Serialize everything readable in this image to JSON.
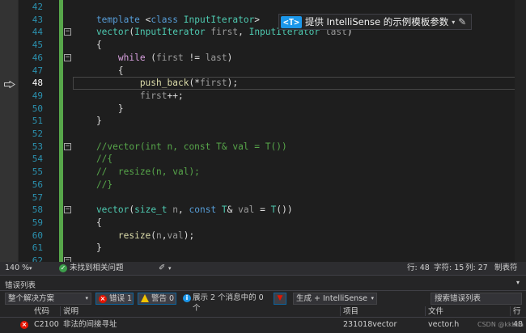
{
  "editor": {
    "lines": [
      {
        "n": "42",
        "fold": "",
        "tokens": [
          {
            "t": "",
            "c": ""
          }
        ]
      },
      {
        "n": "43",
        "fold": "",
        "tokens": [
          {
            "t": "    template ",
            "c": "kw"
          },
          {
            "t": "<",
            "c": ""
          },
          {
            "t": "class ",
            "c": "kw"
          },
          {
            "t": "InputIterator",
            "c": "tp"
          },
          {
            "t": ">",
            "c": ""
          }
        ]
      },
      {
        "n": "44",
        "fold": "−",
        "tokens": [
          {
            "t": "    vector",
            "c": "tp"
          },
          {
            "t": "(",
            "c": ""
          },
          {
            "t": "InputIterator",
            "c": "tp"
          },
          {
            "t": " first",
            "c": "pm"
          },
          {
            "t": ", ",
            "c": ""
          },
          {
            "t": "InputIterator",
            "c": "tp"
          },
          {
            "t": " last",
            "c": "pm"
          },
          {
            "t": ")",
            "c": ""
          }
        ]
      },
      {
        "n": "45",
        "fold": "",
        "tokens": [
          {
            "t": "    {",
            "c": ""
          }
        ]
      },
      {
        "n": "46",
        "fold": "−",
        "tokens": [
          {
            "t": "        while",
            "c": "ctl"
          },
          {
            "t": " (",
            "c": ""
          },
          {
            "t": "first",
            "c": "pm"
          },
          {
            "t": " != ",
            "c": ""
          },
          {
            "t": "last",
            "c": "pm"
          },
          {
            "t": ")",
            "c": ""
          }
        ]
      },
      {
        "n": "47",
        "fold": "",
        "tokens": [
          {
            "t": "        {",
            "c": ""
          }
        ]
      },
      {
        "n": "48",
        "fold": "",
        "current": true,
        "tokens": [
          {
            "t": "            push_back",
            "c": "fn"
          },
          {
            "t": "(*",
            "c": ""
          },
          {
            "t": "first",
            "c": "pm"
          },
          {
            "t": ");",
            "c": ""
          }
        ]
      },
      {
        "n": "49",
        "fold": "",
        "tokens": [
          {
            "t": "            first",
            "c": "pm"
          },
          {
            "t": "++;",
            "c": ""
          }
        ]
      },
      {
        "n": "50",
        "fold": "",
        "tokens": [
          {
            "t": "        }",
            "c": ""
          }
        ]
      },
      {
        "n": "51",
        "fold": "",
        "tokens": [
          {
            "t": "    }",
            "c": ""
          }
        ]
      },
      {
        "n": "52",
        "fold": "",
        "tokens": [
          {
            "t": "",
            "c": ""
          }
        ]
      },
      {
        "n": "53",
        "fold": "−",
        "tokens": [
          {
            "t": "    //vector(int n, const T& val = T())",
            "c": "cm"
          }
        ]
      },
      {
        "n": "54",
        "fold": "",
        "tokens": [
          {
            "t": "    //{",
            "c": "cm"
          }
        ]
      },
      {
        "n": "55",
        "fold": "",
        "tokens": [
          {
            "t": "    //  resize(n, val);",
            "c": "cm"
          }
        ]
      },
      {
        "n": "56",
        "fold": "",
        "tokens": [
          {
            "t": "    //}",
            "c": "cm"
          }
        ]
      },
      {
        "n": "57",
        "fold": "",
        "tokens": [
          {
            "t": "",
            "c": ""
          }
        ]
      },
      {
        "n": "58",
        "fold": "−",
        "tokens": [
          {
            "t": "    vector",
            "c": "tp"
          },
          {
            "t": "(",
            "c": ""
          },
          {
            "t": "size_t",
            "c": "tp"
          },
          {
            "t": " n",
            "c": "pm"
          },
          {
            "t": ", ",
            "c": ""
          },
          {
            "t": "const ",
            "c": "kw"
          },
          {
            "t": "T",
            "c": "tp"
          },
          {
            "t": "& ",
            "c": ""
          },
          {
            "t": "val",
            "c": "pm"
          },
          {
            "t": " = ",
            "c": ""
          },
          {
            "t": "T",
            "c": "tp"
          },
          {
            "t": "())",
            "c": ""
          }
        ]
      },
      {
        "n": "59",
        "fold": "",
        "tokens": [
          {
            "t": "    {",
            "c": ""
          }
        ]
      },
      {
        "n": "60",
        "fold": "",
        "tokens": [
          {
            "t": "        resize",
            "c": "fn"
          },
          {
            "t": "(",
            "c": ""
          },
          {
            "t": "n",
            "c": "pm"
          },
          {
            "t": ",",
            "c": ""
          },
          {
            "t": "val",
            "c": "pm"
          },
          {
            "t": ");",
            "c": ""
          }
        ]
      },
      {
        "n": "61",
        "fold": "",
        "tokens": [
          {
            "t": "    }",
            "c": ""
          }
        ]
      },
      {
        "n": "62",
        "fold": "−",
        "tokens": [
          {
            "t": "",
            "c": ""
          }
        ]
      }
    ],
    "intellisense": {
      "badge": "<T>",
      "label": "提供 IntelliSense 的示例模板参数",
      "dropdown": "▾",
      "pencil": "✎"
    }
  },
  "status": {
    "zoom": "140 %",
    "zoom_caret": "▾",
    "ok_icon": "✓",
    "issues": "未找到相关问题",
    "brush_icon": "✐",
    "brush_caret": "▾",
    "line": "行: 48",
    "char": "字符: 15",
    "col": "列: 27",
    "tab": "制表符"
  },
  "error_list": {
    "title": "错误列表",
    "pin": "▾",
    "scope": "整个解决方案",
    "scope_caret": "▾",
    "errors": "错误 1",
    "err_icon": "×",
    "warnings": "警告 0",
    "messages": "展示 2 个消息中的 0 个",
    "info_icon": "i",
    "filter_icon": "▼",
    "build": "生成 + IntelliSense",
    "build_caret": "▾",
    "search_placeholder": "搜索错误列表",
    "columns": {
      "code": "代码",
      "description": "说明",
      "project": "项目",
      "file": "文件",
      "line": "行"
    },
    "row": {
      "icon": "×",
      "code": "C2100",
      "description": "非法的间接寻址",
      "project": "231018vector",
      "file": "vector.h",
      "line": "48"
    },
    "watermark": "CSDN @kkbca"
  }
}
